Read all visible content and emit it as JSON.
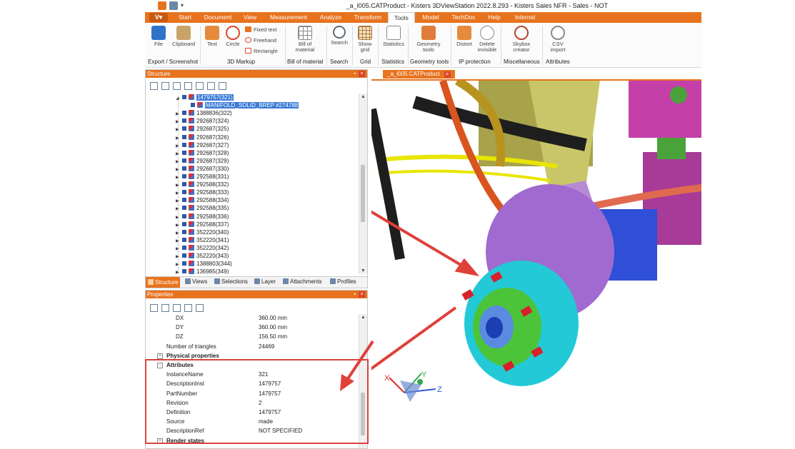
{
  "window": {
    "title": "_a_l005.CATProduct - Kisters 3DViewStation 2022.8.293 - Kisters Sales NFR - Sales - NOT"
  },
  "app_button": {
    "label": "V"
  },
  "ribbon_tabs": [
    {
      "label": "Start",
      "active": false
    },
    {
      "label": "Document",
      "active": false
    },
    {
      "label": "View",
      "active": false
    },
    {
      "label": "Measurement",
      "active": false
    },
    {
      "label": "Analyze",
      "active": false
    },
    {
      "label": "Transform",
      "active": false
    },
    {
      "label": "Tools",
      "active": true
    },
    {
      "label": "Model",
      "active": false
    },
    {
      "label": "TechDoc",
      "active": false
    },
    {
      "label": "Help",
      "active": false
    },
    {
      "label": "Internal",
      "active": false
    }
  ],
  "ribbon": {
    "file": {
      "label": "File",
      "icon": "file-icon"
    },
    "clipboard": {
      "label": "Clipboard",
      "icon": "clipboard-icon"
    },
    "group_export": "Export / Screenshot",
    "text": {
      "label": "Text",
      "icon": "text-markup-icon"
    },
    "circle": {
      "label": "Circle",
      "icon": "circle-markup-icon"
    },
    "fixed_text": {
      "label": "Fixed text"
    },
    "freehand": {
      "label": "Freehand"
    },
    "rectangle": {
      "label": "Rectangle"
    },
    "group_markup": "3D Markup",
    "bom": {
      "label1": "Bill of",
      "label2": "material",
      "icon": "bill-of-material-icon"
    },
    "group_bom": "Bill of material",
    "search": {
      "label": "Search",
      "icon": "search-icon"
    },
    "group_search": "Search",
    "grid": {
      "label1": "Show",
      "label2": "grid",
      "icon": "grid-icon"
    },
    "group_grid": "Grid",
    "statistics": {
      "label": "Statistics",
      "icon": "statistics-icon"
    },
    "group_statistics": "Statistics",
    "geometry": {
      "label1": "Geometry",
      "label2": "tools",
      "icon": "geometry-tools-icon"
    },
    "group_geometry": "Geometry tools",
    "distort": {
      "label": "Distort",
      "icon": "distort-icon"
    },
    "delete_invisible": {
      "label1": "Delete",
      "label2": "invisible",
      "icon": "delete-invisible-icon"
    },
    "group_ip": "IP protection",
    "skybox": {
      "label1": "Skybox",
      "label2": "creator",
      "icon": "skybox-icon"
    },
    "group_misc": "Miscellaneous",
    "csv": {
      "label1": "CSV",
      "label2": "import",
      "icon": "csv-import-icon"
    },
    "group_attr": "Attributes"
  },
  "structure_panel": {
    "title": "Structure",
    "tree": [
      {
        "label": "1479757(321)",
        "level": 0,
        "selected": true,
        "expanded": true
      },
      {
        "label": "MANIFOLD_SOLID_BREP #274788",
        "level": 1,
        "selected": true
      },
      {
        "label": "1388836(322)",
        "level": 0
      },
      {
        "label": "292687(324)",
        "level": 0
      },
      {
        "label": "292687(325)",
        "level": 0
      },
      {
        "label": "292687(326)",
        "level": 0
      },
      {
        "label": "292687(327)",
        "level": 0
      },
      {
        "label": "292687(328)",
        "level": 0
      },
      {
        "label": "292687(329)",
        "level": 0
      },
      {
        "label": "292687(330)",
        "level": 0
      },
      {
        "label": "292588(331)",
        "level": 0
      },
      {
        "label": "292588(332)",
        "level": 0
      },
      {
        "label": "292588(333)",
        "level": 0
      },
      {
        "label": "292588(334)",
        "level": 0
      },
      {
        "label": "292588(335)",
        "level": 0
      },
      {
        "label": "292588(336)",
        "level": 0
      },
      {
        "label": "292588(337)",
        "level": 0
      },
      {
        "label": "352220(340)",
        "level": 0
      },
      {
        "label": "352220(341)",
        "level": 0
      },
      {
        "label": "352220(342)",
        "level": 0
      },
      {
        "label": "352220(343)",
        "level": 0
      },
      {
        "label": "1388803(344)",
        "level": 0
      },
      {
        "label": "136985(349)",
        "level": 0
      }
    ],
    "tabs": [
      {
        "label": "Structure",
        "active": true
      },
      {
        "label": "Views"
      },
      {
        "label": "Selections"
      },
      {
        "label": "Layer"
      },
      {
        "label": "Attachments"
      },
      {
        "label": "Profiles"
      }
    ]
  },
  "properties_panel": {
    "title": "Properties",
    "rows": [
      {
        "key": "DX",
        "value": "360.00 mm",
        "indent": 2
      },
      {
        "key": "DY",
        "value": "360.00 mm",
        "indent": 2
      },
      {
        "key": "DZ",
        "value": "156.50 mm",
        "indent": 2
      },
      {
        "key": "Number of triangles",
        "value": "24469",
        "indent": 1
      },
      {
        "key": "Physical properties",
        "value": "",
        "indent": 1,
        "section": true,
        "toggle": "+"
      },
      {
        "key": "Attributes",
        "value": "",
        "indent": 1,
        "section": true,
        "toggle": "−"
      },
      {
        "key": "InstanceName",
        "value": "321",
        "indent": 1
      },
      {
        "key": "DescriptionInst",
        "value": "1479757",
        "indent": 1
      },
      {
        "key": "PartNumber",
        "value": "1479757",
        "indent": 1
      },
      {
        "key": "Revision",
        "value": "2",
        "indent": 1
      },
      {
        "key": "Definition",
        "value": "1479757",
        "indent": 1
      },
      {
        "key": "Source",
        "value": "made",
        "indent": 1
      },
      {
        "key": "DescriptionRef",
        "value": "NOT SPECIFIED",
        "indent": 1
      },
      {
        "key": "Render states",
        "value": "",
        "indent": 1,
        "section": true,
        "toggle": "+"
      }
    ]
  },
  "document_tab": {
    "label": "_a_l005.CATProduct"
  },
  "axis_triad": {
    "x": "X",
    "y": "Y",
    "z": "Z"
  },
  "colors": {
    "accent": "#e8731e",
    "annotation": "#d9443c"
  }
}
